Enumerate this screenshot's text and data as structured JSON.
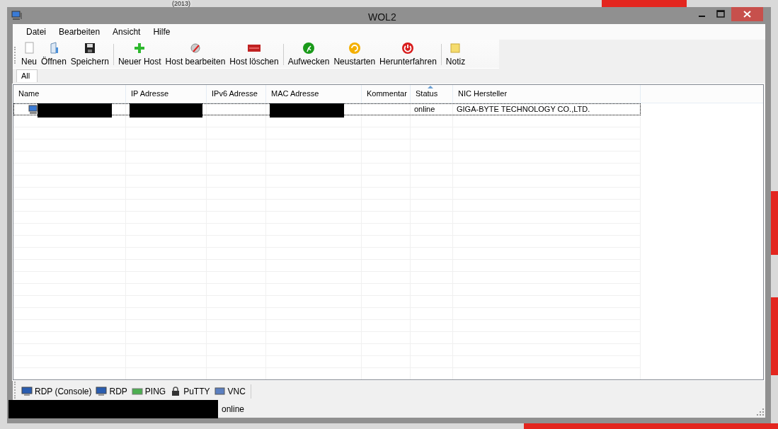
{
  "desktop": {
    "caption": "(2013)"
  },
  "window": {
    "title": "WOL2"
  },
  "menu": [
    "Datei",
    "Bearbeiten",
    "Ansicht",
    "Hilfe"
  ],
  "toolbar": [
    [
      {
        "label": "Neu",
        "kind": "new"
      },
      {
        "label": "Öffnen",
        "kind": "open"
      },
      {
        "label": "Speichern",
        "kind": "save"
      }
    ],
    [
      {
        "label": "Neuer Host",
        "kind": "add"
      },
      {
        "label": "Host bearbeiten",
        "kind": "edit"
      },
      {
        "label": "Host löschen",
        "kind": "delete"
      }
    ],
    [
      {
        "label": "Aufwecken",
        "kind": "wake"
      },
      {
        "label": "Neustarten",
        "kind": "restart"
      },
      {
        "label": "Herunterfahren",
        "kind": "shutdown"
      }
    ],
    [
      {
        "label": "Notiz",
        "kind": "note"
      }
    ]
  ],
  "tabs": [
    {
      "label": "All",
      "selected": true
    }
  ],
  "table": {
    "columns": [
      {
        "label": "Name",
        "sorted": false
      },
      {
        "label": "IP Adresse",
        "sorted": false
      },
      {
        "label": "IPv6 Adresse",
        "sorted": false
      },
      {
        "label": "MAC Adresse",
        "sorted": false
      },
      {
        "label": "Kommentar",
        "sorted": false
      },
      {
        "label": "Status",
        "sorted": true
      },
      {
        "label": "NIC Hersteller",
        "sorted": false
      }
    ],
    "rows": [
      {
        "focused": true,
        "cells": [
          {
            "redacted": true
          },
          {
            "redacted": true
          },
          {
            "text": ""
          },
          {
            "redacted": true
          },
          {
            "text": ""
          },
          {
            "text": "online"
          },
          {
            "text": "GIGA-BYTE TECHNOLOGY CO.,LTD."
          }
        ]
      }
    ]
  },
  "tools": [
    {
      "label": "RDP (Console)",
      "kind": "rdp"
    },
    {
      "label": "RDP",
      "kind": "rdp"
    },
    {
      "label": "PING",
      "kind": "ping"
    },
    {
      "label": "PuTTY",
      "kind": "putty"
    },
    {
      "label": "VNC",
      "kind": "vnc"
    }
  ],
  "status_bar": [
    {
      "redacted": true
    },
    {
      "text": "online"
    }
  ]
}
